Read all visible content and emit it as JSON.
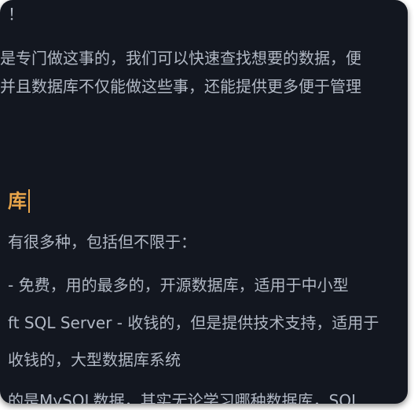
{
  "editor": {
    "lines": [
      "！",
      "是专门做这事的，我们可以快速查找想要的数据，便",
      "并且数据库不仅能做这些事，还能提供更多便于管理",
      "有很多种，包括但不限于：",
      "- 免费，用的最多的，开源数据库，适用于中小型",
      "ft SQL Server - 收钱的，但是提供技术支持，适用于",
      "收钱的，大型数据库系统",
      "的是MySQL数据，其实无论学习哪种数据库，SQL"
    ],
    "heading": "库"
  },
  "colors": {
    "background": "#131720",
    "text": "#b1b8c4",
    "heading": "#e8a54a"
  }
}
